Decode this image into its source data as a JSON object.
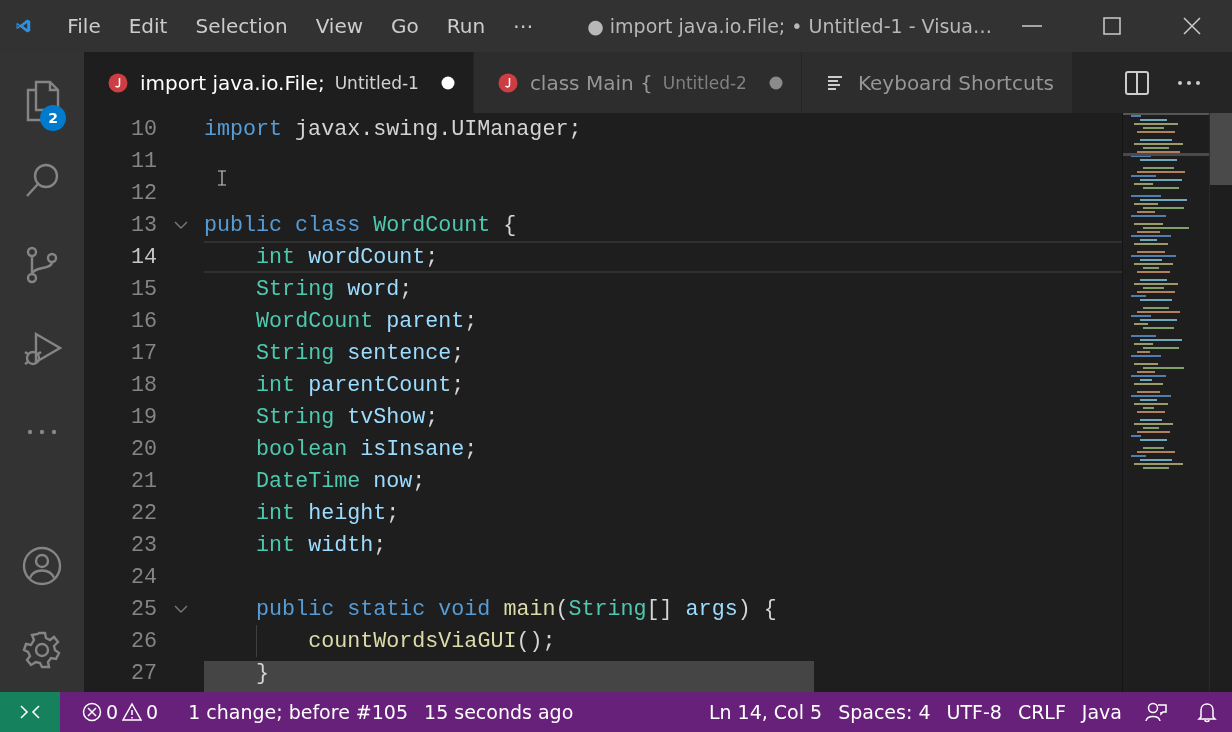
{
  "window": {
    "title": "● import java.io.File; • Untitled-1 - Visua…",
    "menu": [
      "File",
      "Edit",
      "Selection",
      "View",
      "Go",
      "Run",
      "⋯"
    ]
  },
  "activity_bar": {
    "explorer_badge": "2"
  },
  "tabs": [
    {
      "label": "import java.io.File;",
      "description": "Untitled-1",
      "kind": "java",
      "selected": true,
      "dirty": true
    },
    {
      "label": "class Main {",
      "description": "Untitled-2",
      "kind": "java",
      "selected": false,
      "dirty": true
    },
    {
      "label": "Keyboard Shortcuts",
      "kind": "shortcuts",
      "selected": false,
      "dirty": false
    }
  ],
  "editor": {
    "lines": [
      {
        "number": "10",
        "current": false,
        "tokens": [
          {
            "kind": "keyword",
            "text": "import"
          },
          {
            "kind": "plain",
            "text": "javax.swing.UIManager;"
          }
        ]
      },
      {
        "number": "11",
        "current": false
      },
      {
        "number": "12",
        "current": false
      },
      {
        "number": "13",
        "current": false,
        "tokens": [
          {
            "kind": "keyword",
            "text": "public"
          },
          {
            "kind": "keyword",
            "text": "class"
          },
          {
            "kind": "type",
            "text": "WordCount"
          },
          {
            "kind": "plain",
            "text": "{"
          }
        ],
        "children": [
          {
            "number": "14",
            "current": true,
            "tokens": [
              {
                "kind": "type",
                "text": "int"
              },
              {
                "kind": "variable",
                "text": "wordCount"
              },
              {
                "kind": "plain",
                "text": ";",
                "attach": true
              }
            ]
          },
          {
            "number": "15",
            "current": false,
            "tokens": [
              {
                "kind": "type",
                "text": "String"
              },
              {
                "kind": "variable",
                "text": "word"
              },
              {
                "kind": "plain",
                "text": ";",
                "attach": true
              }
            ]
          },
          {
            "number": "16",
            "current": false,
            "tokens": [
              {
                "kind": "type",
                "text": "WordCount"
              },
              {
                "kind": "variable",
                "text": "parent"
              },
              {
                "kind": "plain",
                "text": ";",
                "attach": true
              }
            ]
          },
          {
            "number": "17",
            "current": false,
            "tokens": [
              {
                "kind": "type",
                "text": "String"
              },
              {
                "kind": "variable",
                "text": "sentence"
              },
              {
                "kind": "plain",
                "text": ";",
                "attach": true
              }
            ]
          },
          {
            "number": "18",
            "current": false,
            "tokens": [
              {
                "kind": "type",
                "text": "int"
              },
              {
                "kind": "variable",
                "text": "parentCount"
              },
              {
                "kind": "plain",
                "text": ";",
                "attach": true
              }
            ]
          },
          {
            "number": "19",
            "current": false,
            "tokens": [
              {
                "kind": "type",
                "text": "String"
              },
              {
                "kind": "variable",
                "text": "tvShow"
              },
              {
                "kind": "plain",
                "text": ";",
                "attach": true
              }
            ]
          },
          {
            "number": "20",
            "current": false,
            "tokens": [
              {
                "kind": "type",
                "text": "boolean"
              },
              {
                "kind": "variable",
                "text": "isInsane"
              },
              {
                "kind": "plain",
                "text": ";",
                "attach": true
              }
            ]
          },
          {
            "number": "21",
            "current": false,
            "tokens": [
              {
                "kind": "type",
                "text": "DateTime"
              },
              {
                "kind": "variable",
                "text": "now"
              },
              {
                "kind": "plain",
                "text": ";",
                "attach": true
              }
            ]
          },
          {
            "number": "22",
            "current": false,
            "tokens": [
              {
                "kind": "type",
                "text": "int"
              },
              {
                "kind": "variable",
                "text": "height"
              },
              {
                "kind": "plain",
                "text": ";",
                "attach": true
              }
            ]
          },
          {
            "number": "23",
            "current": false,
            "tokens": [
              {
                "kind": "type",
                "text": "int"
              },
              {
                "kind": "variable",
                "text": "width"
              },
              {
                "kind": "plain",
                "text": ";",
                "attach": true
              }
            ]
          },
          {
            "number": "24",
            "current": false
          },
          {
            "number": "25",
            "current": false,
            "tokens": [
              {
                "kind": "keyword",
                "text": "public"
              },
              {
                "kind": "keyword",
                "text": "static"
              },
              {
                "kind": "keyword",
                "text": "void"
              },
              {
                "kind": "function",
                "text": "main"
              },
              {
                "kind": "plain",
                "text": "(",
                "attach": true
              },
              {
                "kind": "type",
                "text": "String",
                "attach": true
              },
              {
                "kind": "plain",
                "text": "[]",
                "attach": true
              },
              {
                "kind": "variable",
                "text": "args"
              },
              {
                "kind": "plain",
                "text": ") {",
                "attach": true
              }
            ],
            "children": [
              {
                "number": "26",
                "current": false,
                "tokens": [
                  {
                    "kind": "function",
                    "text": "countWordsViaGUI"
                  },
                  {
                    "kind": "plain",
                    "text": "();",
                    "attach": true
                  }
                ]
              }
            ]
          },
          {
            "number": "27",
            "current": false,
            "tokens": [
              {
                "kind": "plain",
                "text": "}"
              }
            ]
          }
        ]
      }
    ]
  },
  "status_bar": {
    "problems": {
      "errors": "0",
      "warnings": "0"
    },
    "left": [
      "1 change; before #105",
      "15 seconds ago"
    ],
    "right": [
      "Ln 14, Col 5",
      "Spaces: 4",
      "UTF-8",
      "CRLF",
      "Java"
    ]
  }
}
